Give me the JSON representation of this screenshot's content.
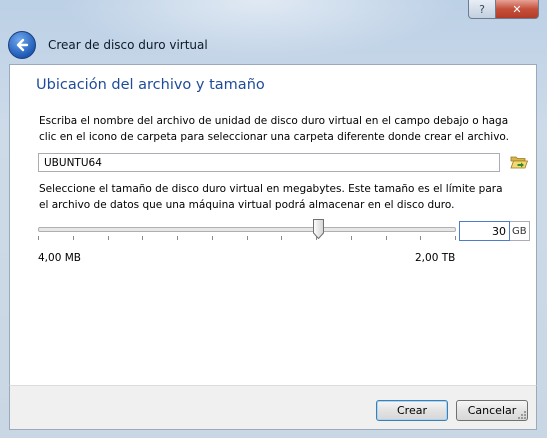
{
  "window": {
    "title": "Crear de disco duro virtual",
    "help_glyph": "?",
    "close_glyph": "✕"
  },
  "section": {
    "title": "Ubicación del archivo y tamaño"
  },
  "location": {
    "description": "Escriba el nombre del archivo de unidad de disco duro virtual en el campo debajo o haga clic en el icono de carpeta para seleccionar una carpeta diferente donde crear el archivo.",
    "file_name": "UBUNTU64"
  },
  "size": {
    "description": "Seleccione el tamaño de disco duro virtual en megabytes. Este tamaño es el límite para el archivo de datos que una máquina virtual podrá almacenar en el disco duro.",
    "value": "30",
    "unit": "GB",
    "min_label": "4,00 MB",
    "max_label": "2,00 TB",
    "slider_fraction": 0.672
  },
  "buttons": {
    "create": "Crear",
    "cancel": "Cancelar"
  },
  "icons": {
    "back": "back-arrow-icon",
    "folder": "folder-open-icon"
  },
  "colors": {
    "section_title": "#1f4c99",
    "close_button": "#c4503b"
  }
}
